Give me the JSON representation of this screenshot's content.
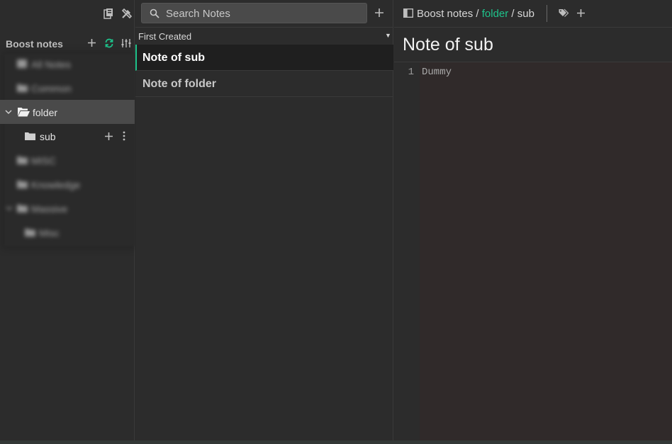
{
  "sidebar": {
    "storage_name": "Boost notes",
    "blurred_rows": [
      {
        "label": "All Notes"
      },
      {
        "label": "Common"
      },
      {
        "label": "MISC"
      },
      {
        "label": "Knowledge"
      },
      {
        "label": "Massive"
      },
      {
        "label": "Misc"
      }
    ],
    "folder": {
      "label": "folder"
    },
    "subfolder": {
      "label": "sub"
    }
  },
  "notelist": {
    "search_placeholder": "Search Notes",
    "sort_label": "First Created",
    "sort_caret": "▼",
    "notes": [
      {
        "title": "Note of sub"
      },
      {
        "title": "Note of folder"
      }
    ]
  },
  "editor": {
    "breadcrumb": {
      "storage": "Boost notes",
      "sep1": " / ",
      "folder": "folder",
      "sep2": " / ",
      "sub": "sub"
    },
    "title": "Note of sub",
    "line_number": "1",
    "content": "Dummy"
  },
  "colors": {
    "accent": "#1ec38b",
    "background": "#2c2c2c",
    "selected_folder_bg": "#4a4a4a",
    "selected_note_bg": "#1f1f1f"
  }
}
